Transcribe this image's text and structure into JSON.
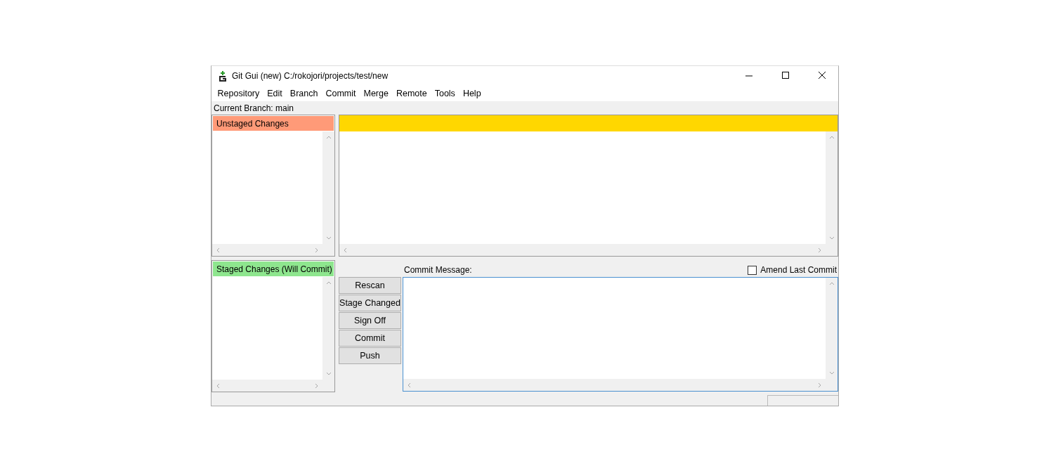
{
  "window": {
    "title": "Git Gui (new) C:/rokojori/projects/test/new"
  },
  "menu": [
    "Repository",
    "Edit",
    "Branch",
    "Commit",
    "Merge",
    "Remote",
    "Tools",
    "Help"
  ],
  "current_branch": "Current Branch: main",
  "unstaged": {
    "title": "Unstaged Changes"
  },
  "staged": {
    "title": "Staged Changes (Will Commit)"
  },
  "commit_message": {
    "label": "Commit Message:"
  },
  "amend": {
    "label": "Amend Last Commit",
    "checked": false
  },
  "buttons": [
    "Rescan",
    "Stage Changed",
    "Sign Off",
    "Commit",
    "Push"
  ]
}
